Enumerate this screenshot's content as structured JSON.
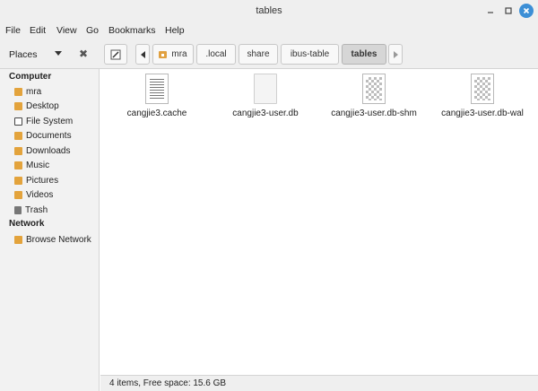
{
  "window": {
    "title": "tables"
  },
  "menu": {
    "items": [
      "File",
      "Edit",
      "View",
      "Go",
      "Bookmarks",
      "Help"
    ]
  },
  "toolbar": {
    "places_label": "Places"
  },
  "breadcrumbs": [
    "mra",
    ".local",
    "share",
    "ibus-table",
    "tables"
  ],
  "sidebar": {
    "computer_label": "Computer",
    "computer_items": [
      "mra",
      "Desktop",
      "File System",
      "Documents",
      "Downloads",
      "Music",
      "Pictures",
      "Videos",
      "Trash"
    ],
    "network_label": "Network",
    "network_items": [
      "Browse Network"
    ]
  },
  "files": [
    {
      "name": "cangjie3.cache",
      "icon": "text-document-icon"
    },
    {
      "name": "cangjie3-user.db",
      "icon": "blank-document-icon"
    },
    {
      "name": "cangjie3-user.db-shm",
      "icon": "binary-file-icon"
    },
    {
      "name": "cangjie3-user.db-wal",
      "icon": "binary-file-icon"
    }
  ],
  "status": {
    "text": "4 items, Free space: 15.6 GB"
  }
}
